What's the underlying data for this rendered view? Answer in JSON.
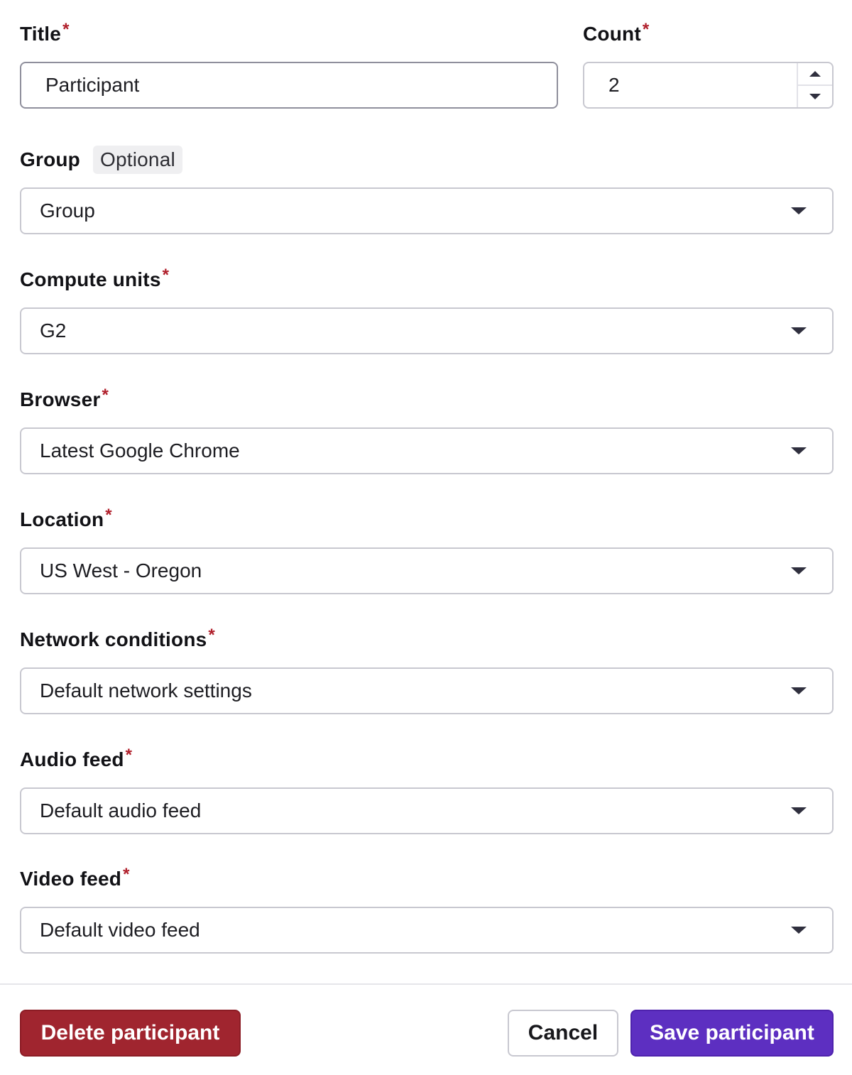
{
  "colors": {
    "required_asterisk": "#b01f2b",
    "delete_button": "#a0252f",
    "save_button": "#5d2fc1"
  },
  "title": {
    "label": "Title",
    "required_marker": "*",
    "value": "Participant"
  },
  "count": {
    "label": "Count",
    "required_marker": "*",
    "value": "2"
  },
  "group": {
    "label": "Group",
    "optional_tag": "Optional",
    "value": "Group"
  },
  "compute_units": {
    "label": "Compute units",
    "required_marker": "*",
    "value": "G2"
  },
  "browser": {
    "label": "Browser",
    "required_marker": "*",
    "value": "Latest Google Chrome"
  },
  "location": {
    "label": "Location",
    "required_marker": "*",
    "value": "US West - Oregon"
  },
  "network_conditions": {
    "label": "Network conditions",
    "required_marker": "*",
    "value": "Default network settings"
  },
  "audio_feed": {
    "label": "Audio feed",
    "required_marker": "*",
    "value": "Default audio feed"
  },
  "video_feed": {
    "label": "Video feed",
    "required_marker": "*",
    "value": "Default video feed"
  },
  "footer": {
    "delete_label": "Delete participant",
    "cancel_label": "Cancel",
    "save_label": "Save participant"
  }
}
